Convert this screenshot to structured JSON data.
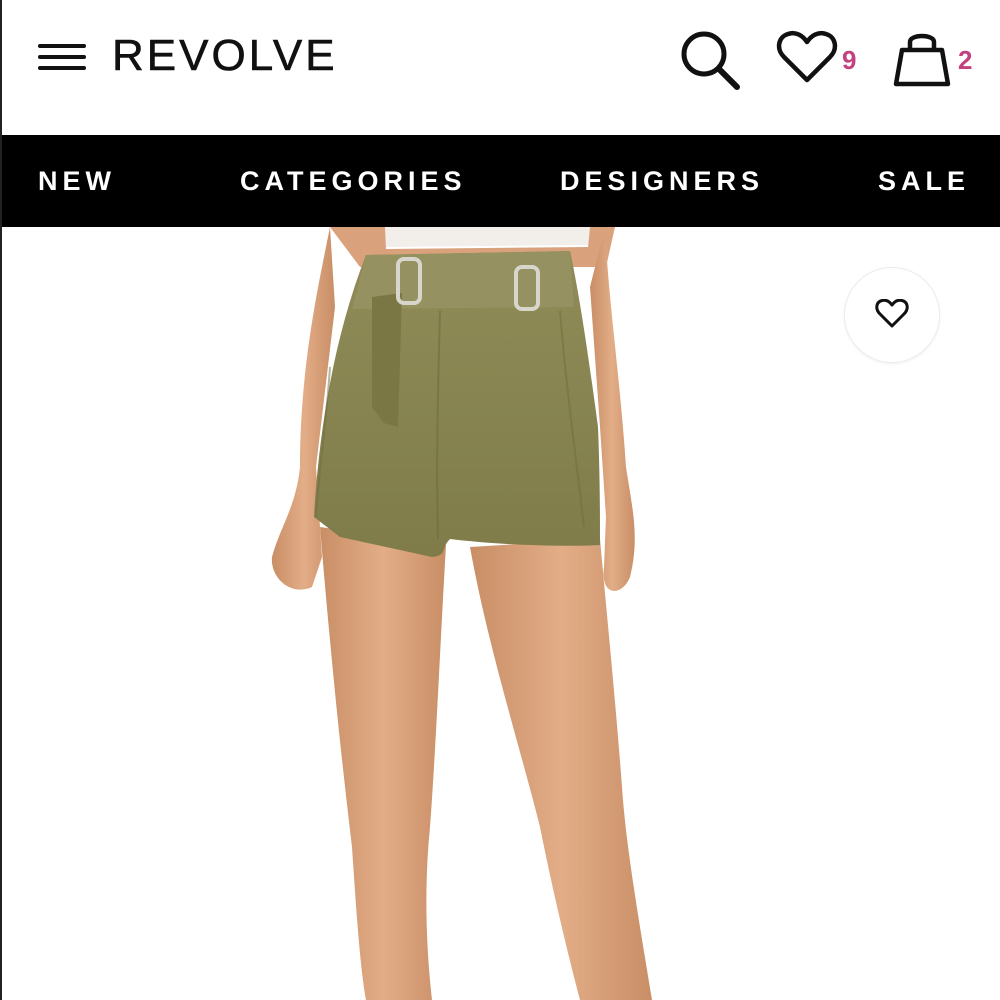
{
  "header": {
    "logo": "REVOLVE",
    "menu_icon": "hamburger-menu-icon",
    "search_icon": "search-icon",
    "wishlist_icon": "heart-icon",
    "wishlist_count": "9",
    "bag_icon": "shopping-bag-icon",
    "bag_count": "2",
    "badge_color": "#c2427f"
  },
  "nav": {
    "items": [
      {
        "label": "NEW"
      },
      {
        "label": "CATEGORIES"
      },
      {
        "label": "DESIGNERS"
      },
      {
        "label": "SALE"
      }
    ],
    "background": "#000000",
    "text_color": "#ffffff"
  },
  "product": {
    "image": "product-photo-olive-belted-shorts",
    "favorite_icon": "heart-outline-icon"
  }
}
